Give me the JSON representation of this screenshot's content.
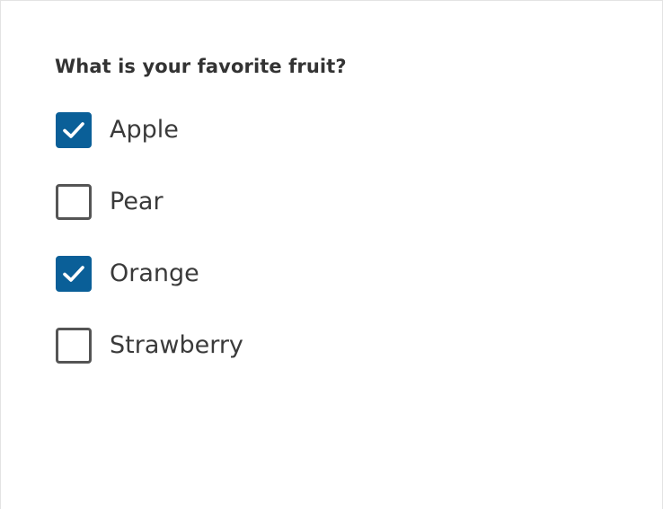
{
  "question": {
    "label": "What is your favorite fruit?"
  },
  "options": [
    {
      "label": "Apple",
      "checked": true
    },
    {
      "label": "Pear",
      "checked": false
    },
    {
      "label": "Orange",
      "checked": true
    },
    {
      "label": "Strawberry",
      "checked": false
    }
  ],
  "colors": {
    "checked_fill": "#0a5f98",
    "unchecked_border": "#555555",
    "text": "#3a3a3a",
    "frame_border": "#e3e3e3"
  },
  "icons": {
    "check": "check-icon"
  }
}
